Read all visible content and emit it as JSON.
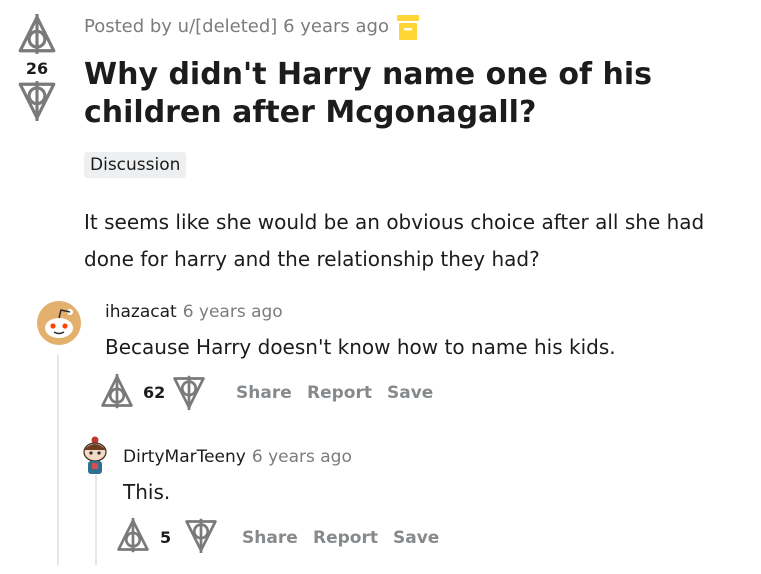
{
  "post": {
    "score": "26",
    "posted_by": "Posted by u/[deleted]",
    "time": "6 years ago",
    "title": "Why didn't Harry name one of his children after Mcgonagall?",
    "flair": "Discussion",
    "body": "It seems like she would be an obvious choice after all she had done for harry and the relationship they had?"
  },
  "comments": [
    {
      "author": "ihazacat",
      "time": "6 years ago",
      "body": "Because Harry doesn't know how to name his kids.",
      "score": "62",
      "actions": {
        "share": "Share",
        "report": "Report",
        "save": "Save"
      }
    },
    {
      "author": "DirtyMarTeeny",
      "time": "6 years ago",
      "body": "This.",
      "score": "5",
      "actions": {
        "share": "Share",
        "report": "Report",
        "save": "Save"
      }
    }
  ],
  "icons": {
    "upvote": "deathly-hallows-upvote-icon",
    "downvote": "deathly-hallows-downvote-icon",
    "archive": "archive-icon"
  },
  "colors": {
    "archive": "#ffd635",
    "meta": "#7c7c7c",
    "action": "#878a8c",
    "flair_bg": "#edeff1"
  }
}
